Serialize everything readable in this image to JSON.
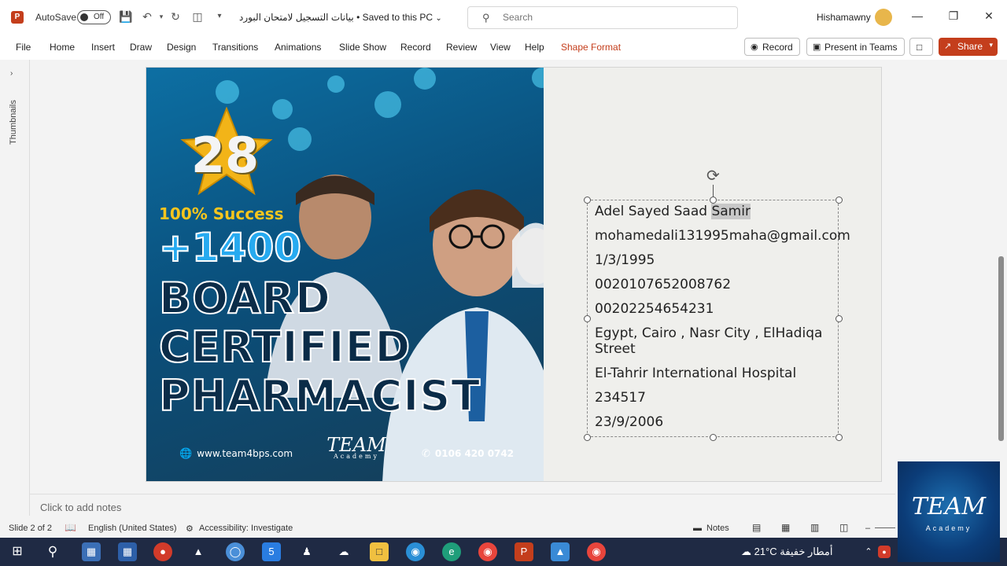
{
  "titlebar": {
    "autosave_label": "AutoSave",
    "autosave_state": "Off",
    "doc_title": "بيانات التسجيل لامتحان البورد • Saved to this PC",
    "search_placeholder": "Search",
    "user_name": "Hishamawny"
  },
  "ribbon": {
    "tabs": [
      "File",
      "Home",
      "Insert",
      "Draw",
      "Design",
      "Transitions",
      "Animations",
      "Slide Show",
      "Record",
      "Review",
      "View",
      "Help",
      "Shape Format"
    ],
    "record_button": "Record",
    "present_teams_button": "Present in Teams",
    "share_button": "Share"
  },
  "left_panel": {
    "label": "Thumbnails"
  },
  "slide": {
    "badge_number": "28",
    "success_text": "100% Success",
    "count_text": "+1400",
    "headline": [
      "BOARD",
      "CERTIFIED",
      "PHARMACIST"
    ],
    "website": "www.team4bps.com",
    "logo_text": "TEAM",
    "logo_subtext": "Academy",
    "phone": "0106 420 0742",
    "textbox_lines": [
      "Adel Sayed Saad ",
      "mohamedali131995maha@gmail.com",
      "1/3/1995",
      "0020107652008762",
      "00202254654231",
      "Egypt, Cairo , Nasr City , ElHadiqa",
      "Street",
      "El-Tahrir International Hospital",
      "234517",
      "23/9/2006"
    ],
    "selected_word": "Samir"
  },
  "notes_placeholder": "Click to add notes",
  "statusbar": {
    "slide_info": "Slide 2 of 2",
    "language": "English (United States)",
    "accessibility": "Accessibility: Investigate",
    "notes_label": "Notes"
  },
  "taskbar": {
    "temperature": "21°C",
    "weather_text": "أمطار خفيفة"
  },
  "overlay_logo": {
    "text": "TEAM",
    "subtext": "Academy"
  },
  "colors": {
    "accent": "#c43e1c",
    "taskbar": "#1f2a44",
    "slide_bg": "#efefec"
  }
}
